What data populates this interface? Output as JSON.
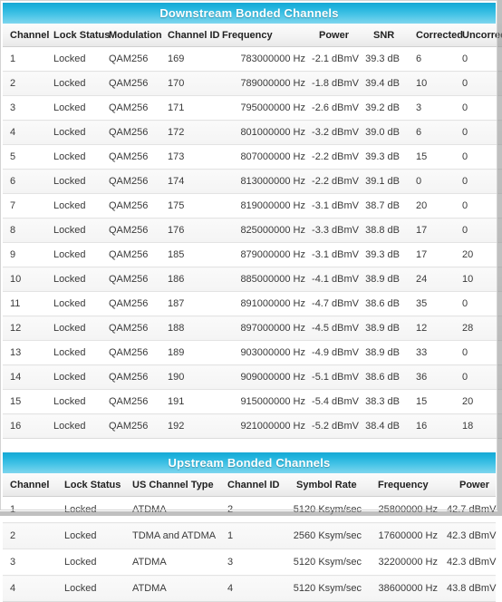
{
  "theme": {
    "header_gradient_top": "#18aad6",
    "header_gradient_bottom": "#7ed6ee",
    "header_text": "#ffffff",
    "table_header_bg": "#f3f3f3",
    "row_divider": "#e3e3e3",
    "body_text": "#3a3a3a"
  },
  "downstream": {
    "title": "Downstream Bonded Channels",
    "columns": [
      "Channel",
      "Lock Status",
      "Modulation",
      "Channel ID",
      "Frequency",
      "Power",
      "SNR",
      "Corrected",
      "Uncorrectables"
    ],
    "rows": [
      [
        "1",
        "Locked",
        "QAM256",
        "169",
        "783000000 Hz",
        "-2.1 dBmV",
        "39.3 dB",
        "6",
        "0"
      ],
      [
        "2",
        "Locked",
        "QAM256",
        "170",
        "789000000 Hz",
        "-1.8 dBmV",
        "39.4 dB",
        "10",
        "0"
      ],
      [
        "3",
        "Locked",
        "QAM256",
        "171",
        "795000000 Hz",
        "-2.6 dBmV",
        "39.2 dB",
        "3",
        "0"
      ],
      [
        "4",
        "Locked",
        "QAM256",
        "172",
        "801000000 Hz",
        "-3.2 dBmV",
        "39.0 dB",
        "6",
        "0"
      ],
      [
        "5",
        "Locked",
        "QAM256",
        "173",
        "807000000 Hz",
        "-2.2 dBmV",
        "39.3 dB",
        "15",
        "0"
      ],
      [
        "6",
        "Locked",
        "QAM256",
        "174",
        "813000000 Hz",
        "-2.2 dBmV",
        "39.1 dB",
        "0",
        "0"
      ],
      [
        "7",
        "Locked",
        "QAM256",
        "175",
        "819000000 Hz",
        "-3.1 dBmV",
        "38.7 dB",
        "20",
        "0"
      ],
      [
        "8",
        "Locked",
        "QAM256",
        "176",
        "825000000 Hz",
        "-3.3 dBmV",
        "38.8 dB",
        "17",
        "0"
      ],
      [
        "9",
        "Locked",
        "QAM256",
        "185",
        "879000000 Hz",
        "-3.1 dBmV",
        "39.3 dB",
        "17",
        "20"
      ],
      [
        "10",
        "Locked",
        "QAM256",
        "186",
        "885000000 Hz",
        "-4.1 dBmV",
        "38.9 dB",
        "24",
        "10"
      ],
      [
        "11",
        "Locked",
        "QAM256",
        "187",
        "891000000 Hz",
        "-4.7 dBmV",
        "38.6 dB",
        "35",
        "0"
      ],
      [
        "12",
        "Locked",
        "QAM256",
        "188",
        "897000000 Hz",
        "-4.5 dBmV",
        "38.9 dB",
        "12",
        "28"
      ],
      [
        "13",
        "Locked",
        "QAM256",
        "189",
        "903000000 Hz",
        "-4.9 dBmV",
        "38.9 dB",
        "33",
        "0"
      ],
      [
        "14",
        "Locked",
        "QAM256",
        "190",
        "909000000 Hz",
        "-5.1 dBmV",
        "38.6 dB",
        "36",
        "0"
      ],
      [
        "15",
        "Locked",
        "QAM256",
        "191",
        "915000000 Hz",
        "-5.4 dBmV",
        "38.3 dB",
        "15",
        "20"
      ],
      [
        "16",
        "Locked",
        "QAM256",
        "192",
        "921000000 Hz",
        "-5.2 dBmV",
        "38.4 dB",
        "16",
        "18"
      ]
    ]
  },
  "upstream": {
    "title": "Upstream Bonded Channels",
    "columns": [
      "Channel",
      "Lock Status",
      "US Channel Type",
      "Channel ID",
      "Symbol Rate",
      "Frequency",
      "Power"
    ],
    "rows": [
      [
        "1",
        "Locked",
        "ATDMA",
        "2",
        "5120 Ksym/sec",
        "25800000 Hz",
        "42.7 dBmV"
      ],
      [
        "2",
        "Locked",
        "TDMA and ATDMA",
        "1",
        "2560 Ksym/sec",
        "17600000 Hz",
        "42.3 dBmV"
      ],
      [
        "3",
        "Locked",
        "ATDMA",
        "3",
        "5120 Ksym/sec",
        "32200000 Hz",
        "42.3 dBmV"
      ],
      [
        "4",
        "Locked",
        "ATDMA",
        "4",
        "5120 Ksym/sec",
        "38600000 Hz",
        "43.8 dBmV"
      ]
    ]
  }
}
